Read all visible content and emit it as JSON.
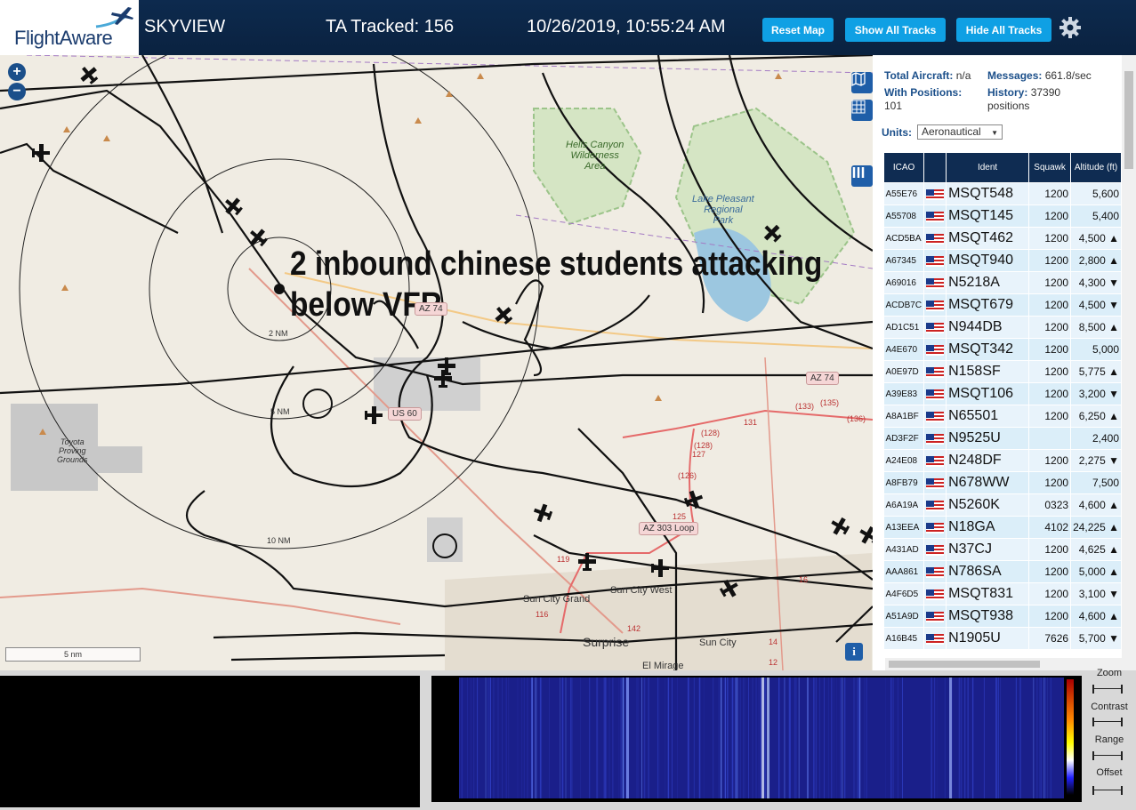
{
  "header": {
    "logo_text": "FlightAware",
    "app_name": "SKYVIEW",
    "tracked": "TA Tracked: 156",
    "datetime": "10/26/2019, 10:55:24 AM",
    "buttons": {
      "reset_map": "Reset Map",
      "show_all": "Show All Tracks",
      "hide_all": "Hide All Tracks"
    }
  },
  "map": {
    "zoom_in": "+",
    "zoom_out": "−",
    "annotation": "2 inbound chinese students attacking\nbelow VFR",
    "labels": {
      "hells_canyon": "Hells Canyon\nWilderness\nArea",
      "lake_pleasant": "Lake Pleasant\nRegional\nPark",
      "toyota": "Toyota\nProving\nGrounds",
      "sun_city_grand": "Sun City Grand",
      "sun_city_west": "Sun City West",
      "surprise": "Surprise",
      "sun_city": "Sun City",
      "el_mirage": "El Mirage",
      "ring_2": "2 NM",
      "ring_5": "5 NM",
      "ring_10": "10 NM",
      "az74_a": "AZ 74",
      "az74_b": "AZ 74",
      "us60": "US 60",
      "az303": "AZ 303 Loop",
      "r131": "131",
      "r133": "(133)",
      "r135": "(135)",
      "r136": "(136)",
      "r128a": "(128)",
      "r128b": "(128)",
      "r127": "127",
      "r126": "(126)",
      "r125": "125",
      "r119": "119",
      "r116": "116",
      "r142": "142",
      "r14": "14",
      "r12": "12",
      "r16": "16"
    },
    "scale": "5 nm",
    "info": "i"
  },
  "panel": {
    "total_aircraft_label": "Total Aircraft:",
    "total_aircraft_value": "n/a",
    "with_positions_label": "With Positions:",
    "with_positions_value": "101",
    "messages_label": "Messages:",
    "messages_value": "661.8/sec",
    "history_label": "History:",
    "history_value": "37390",
    "history_unit": "positions",
    "units_label": "Units:",
    "units_value": "Aeronautical",
    "columns": [
      "ICAO",
      "",
      "Ident",
      "Squawk",
      "Altitude (ft)"
    ],
    "rows": [
      {
        "icao": "A55E76",
        "ident": "MSQT548",
        "squawk": "1200",
        "alt": "5,600"
      },
      {
        "icao": "A55708",
        "ident": "MSQT145",
        "squawk": "1200",
        "alt": "5,400"
      },
      {
        "icao": "ACD5BA",
        "ident": "MSQT462",
        "squawk": "1200",
        "alt": "4,500 ▲"
      },
      {
        "icao": "A67345",
        "ident": "MSQT940",
        "squawk": "1200",
        "alt": "2,800 ▲"
      },
      {
        "icao": "A69016",
        "ident": "N5218A",
        "squawk": "1200",
        "alt": "4,300 ▼"
      },
      {
        "icao": "ACDB7C",
        "ident": "MSQT679",
        "squawk": "1200",
        "alt": "4,500 ▼"
      },
      {
        "icao": "AD1C51",
        "ident": "N944DB",
        "squawk": "1200",
        "alt": "8,500 ▲"
      },
      {
        "icao": "A4E670",
        "ident": "MSQT342",
        "squawk": "1200",
        "alt": "5,000"
      },
      {
        "icao": "A0E97D",
        "ident": "N158SF",
        "squawk": "1200",
        "alt": "5,775 ▲"
      },
      {
        "icao": "A39E83",
        "ident": "MSQT106",
        "squawk": "1200",
        "alt": "3,200 ▼"
      },
      {
        "icao": "A8A1BF",
        "ident": "N65501",
        "squawk": "1200",
        "alt": "6,250 ▲"
      },
      {
        "icao": "AD3F2F",
        "ident": "N9525U",
        "squawk": "",
        "alt": "2,400"
      },
      {
        "icao": "A24E08",
        "ident": "N248DF",
        "squawk": "1200",
        "alt": "2,275 ▼"
      },
      {
        "icao": "A8FB79",
        "ident": "N678WW",
        "squawk": "1200",
        "alt": "7,500"
      },
      {
        "icao": "A6A19A",
        "ident": "N5260K",
        "squawk": "0323",
        "alt": "4,600 ▲"
      },
      {
        "icao": "A13EEA",
        "ident": "N18GA",
        "squawk": "4102",
        "alt": "24,225 ▲"
      },
      {
        "icao": "A431AD",
        "ident": "N37CJ",
        "squawk": "1200",
        "alt": "4,625 ▲"
      },
      {
        "icao": "AAA861",
        "ident": "N786SA",
        "squawk": "1200",
        "alt": "5,000 ▲"
      },
      {
        "icao": "A4F6D5",
        "ident": "MSQT831",
        "squawk": "1200",
        "alt": "3,100 ▼"
      },
      {
        "icao": "A51A9D",
        "ident": "MSQT938",
        "squawk": "1200",
        "alt": "4,600 ▲"
      },
      {
        "icao": "A16B45",
        "ident": "N1905U",
        "squawk": "7626",
        "alt": "5,700 ▼"
      }
    ]
  },
  "spectrum": {
    "zoom": "Zoom",
    "contrast": "Contrast",
    "range": "Range",
    "offset": "Offset"
  },
  "colors": {
    "header_bg": "#0a2240",
    "button_bg": "#0fa0e4",
    "table_header": "#0f2c52",
    "row_bg": "#e8f3fb"
  }
}
